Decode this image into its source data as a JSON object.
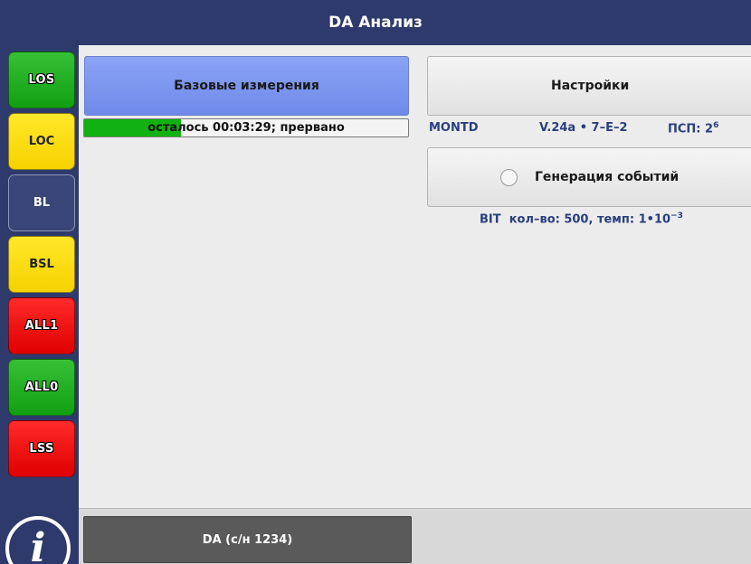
{
  "window": {
    "title": "DA Анализ"
  },
  "sidebar": {
    "indicators": [
      {
        "label": "LOS",
        "color": "#1fae1f"
      },
      {
        "label": "LOC",
        "color": "#f9dc0a"
      },
      {
        "label": "BL",
        "color": "#3a4677"
      },
      {
        "label": "BSL",
        "color": "#f9dc0a"
      },
      {
        "label": "ALL1",
        "color": "#f01010"
      },
      {
        "label": "ALL0",
        "color": "#1fae1f"
      },
      {
        "label": "LSS",
        "color": "#f01010"
      }
    ],
    "info_icon": "i"
  },
  "main": {
    "base_button_label": "Базовые измерения",
    "progress": {
      "text": "осталось 00:03:29; прервано",
      "fraction": 0.3
    },
    "settings_button_label": "Настройки",
    "mode": {
      "protocol": "MONTD",
      "interface": "V.24a • 7–E–2",
      "psp_label": "ПСП: 2",
      "psp_exp": "6"
    },
    "events_button_label": "Генерация событий",
    "bit": {
      "type": "BIT",
      "details": "кол–во: 500, темп: 1•10",
      "exp": "−3"
    }
  },
  "bottom": {
    "tab_label": "DA (с/н 1234)"
  },
  "colors": {
    "header": "#2e3a6b",
    "accent_button": "#7e97f0",
    "progress_fill": "#11b111",
    "info_text": "#2a3f7e"
  }
}
